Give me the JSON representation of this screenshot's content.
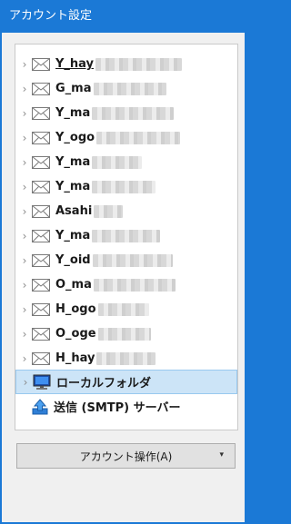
{
  "window": {
    "title": "アカウント設定"
  },
  "accounts": [
    {
      "label": "Y_hay",
      "underline": true
    },
    {
      "label": "G_ma"
    },
    {
      "label": "Y_ma"
    },
    {
      "label": "Y_ogo"
    },
    {
      "label": "Y_ma"
    },
    {
      "label": "Y_ma"
    },
    {
      "label": "Asahi"
    },
    {
      "label": "Y_ma"
    },
    {
      "label": "Y_oid"
    },
    {
      "label": "O_ma"
    },
    {
      "label": "H_ogo"
    },
    {
      "label": "O_oge"
    },
    {
      "label": "H_hay"
    }
  ],
  "local_folder": {
    "label": "ローカルフォルダ"
  },
  "smtp": {
    "label": "送信 (SMTP) サーバー"
  },
  "account_actions": {
    "label": "アカウント操作(A)"
  },
  "colors": {
    "titlebar": "#1b79d6",
    "selected_row": "#cce4f7"
  },
  "icons": {
    "expand": "chevron-right-icon",
    "account": "mail-icon",
    "local": "computer-icon",
    "smtp": "upload-icon"
  }
}
